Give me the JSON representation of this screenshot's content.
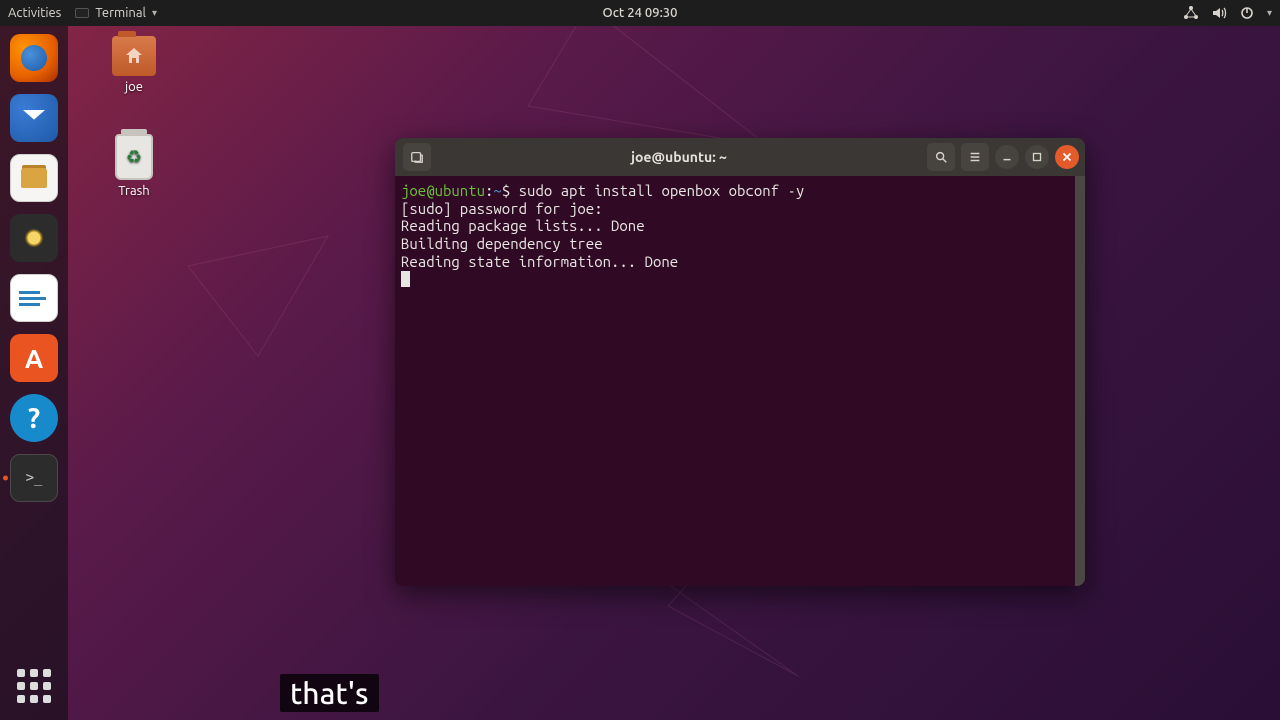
{
  "topbar": {
    "activities": "Activities",
    "app_name": "Terminal",
    "clock": "Oct 24  09:30"
  },
  "desktop_icons": {
    "home": {
      "label": "joe"
    },
    "trash": {
      "label": "Trash"
    }
  },
  "terminal": {
    "title": "joe@ubuntu: ~",
    "prompt": {
      "userhost": "joe@ubuntu",
      "sep": ":",
      "path": "~",
      "sigil": "$"
    },
    "command": "sudo apt install openbox obconf -y",
    "output": [
      "[sudo] password for joe:",
      "Reading package lists... Done",
      "Building dependency tree",
      "Reading state information... Done"
    ]
  },
  "caption": "that's",
  "colors": {
    "accent_orange": "#e95420",
    "terminal_bg": "#300a24",
    "prompt_green": "#6cbf3a"
  }
}
